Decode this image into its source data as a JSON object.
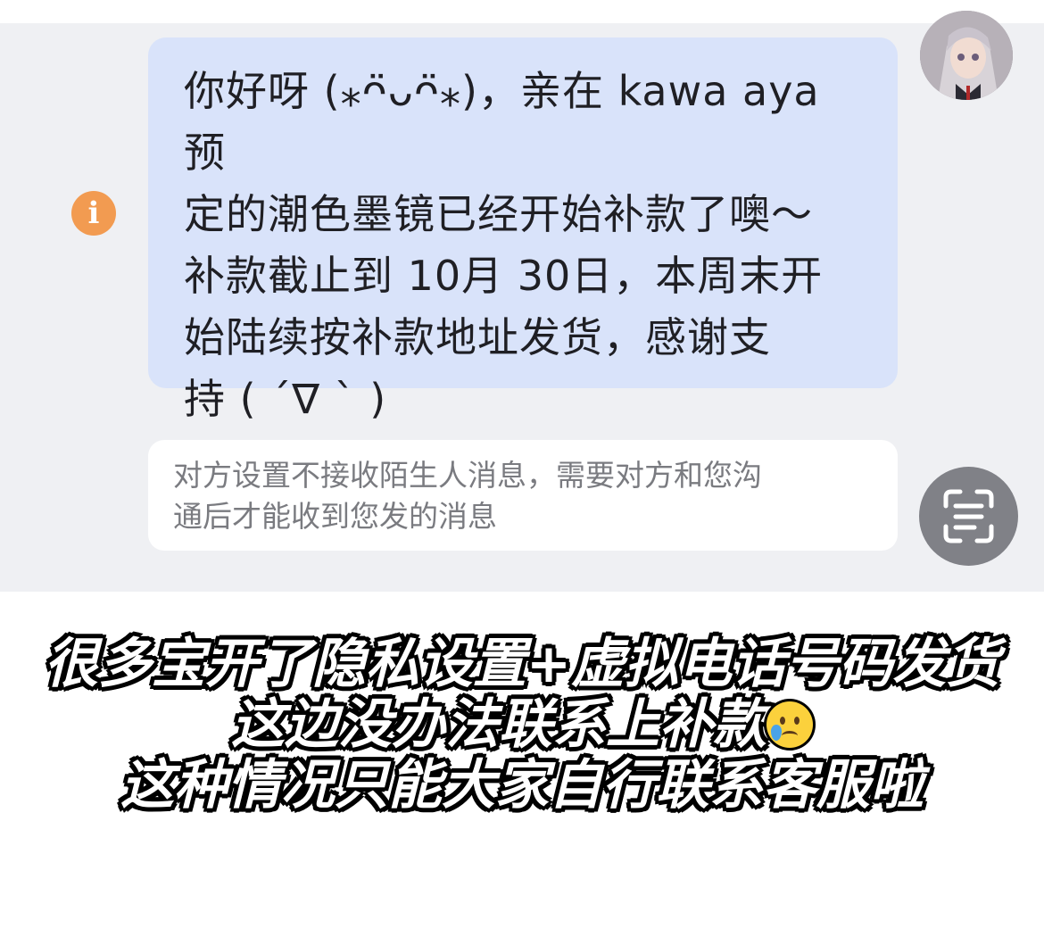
{
  "chat": {
    "message": "你好呀 (⁎ᴖ̈ᴗᴖ̈⁎)，亲在 kawa aya 预\n定的潮色墨镜已经开始补款了噢～\n补款截止到 10月 30日，本周末开\n始陆续按补款地址发货，感谢支\n持 ( ´∇ ` )",
    "info_icon_glyph": "i",
    "notice": "对方设置不接收陌生人消息，需要对方和您沟\n通后才能收到您发的消息",
    "avatar_icon": "avatar-image",
    "scan_icon": "scan-text-icon"
  },
  "caption": {
    "line1": "很多宝开了隐私设置+虚拟电话号码发货",
    "line2": "这边没办法联系上补款",
    "line2_emoji": "face-holding-back-tears-emoji",
    "line3": "这种情况只能大家自行联系客服啦"
  },
  "colors": {
    "chat_background": "#eff0f3",
    "bubble": "#d9e3fa",
    "info_icon": "#f29b51",
    "notice_text": "#7a7b80",
    "scan_button": "#808187"
  }
}
